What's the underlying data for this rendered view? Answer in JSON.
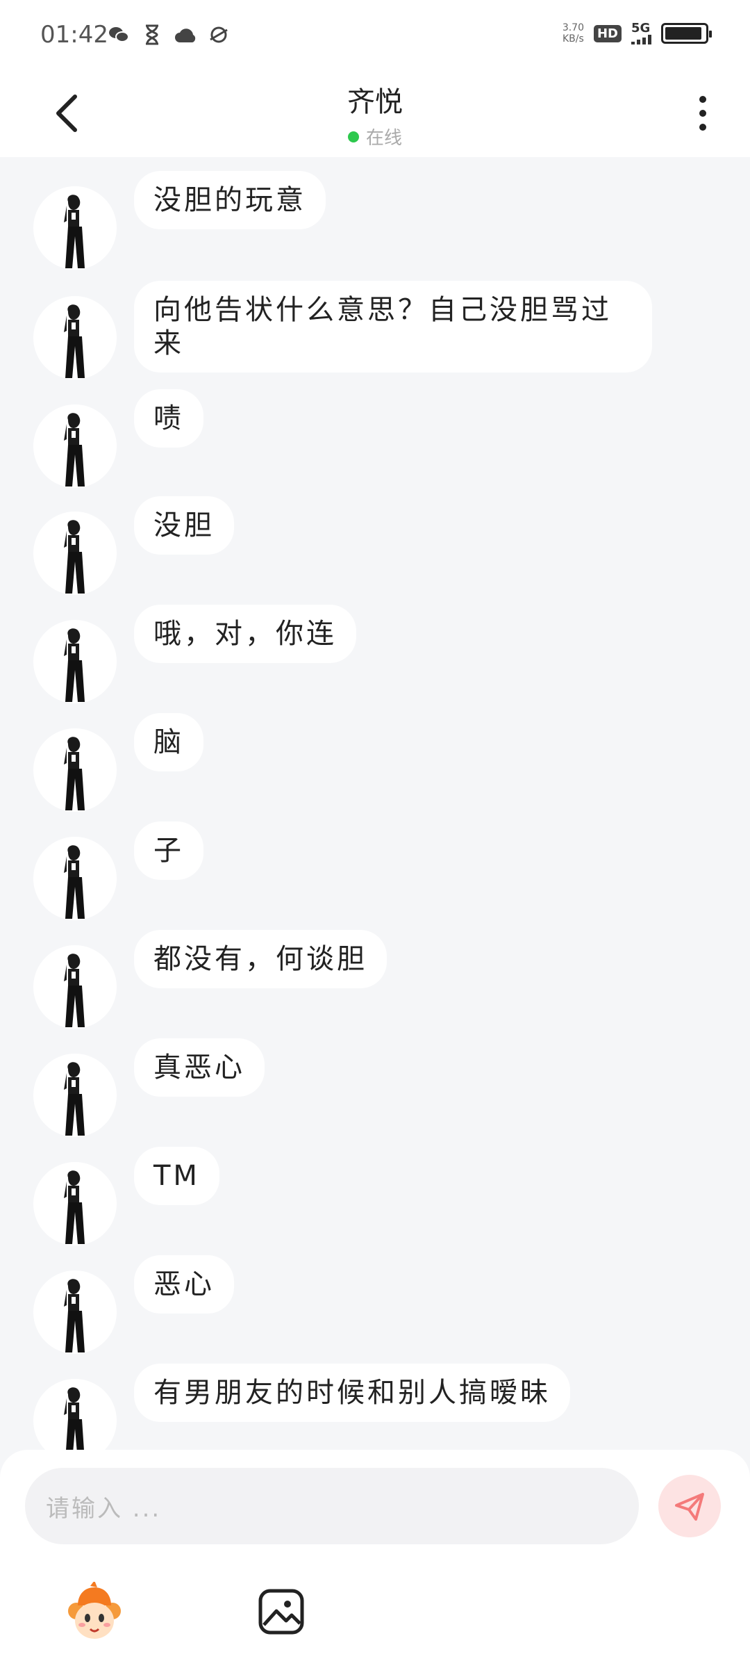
{
  "status_bar": {
    "time": "01:42",
    "speed_value": "3.70",
    "speed_unit": "KB/s",
    "hd_label": "HD",
    "network_label": "5G",
    "battery_level": 0.92
  },
  "header": {
    "title": "齐悦",
    "status": "在线"
  },
  "messages": [
    {
      "text": "没胆的玩意"
    },
    {
      "text": "向他告状什么意思？自己没胆骂过来"
    },
    {
      "text": "啧"
    },
    {
      "text": "没胆"
    },
    {
      "text": "哦，对，你连"
    },
    {
      "text": "脑"
    },
    {
      "text": "子"
    },
    {
      "text": "都没有，何谈胆"
    },
    {
      "text": "真恶心"
    },
    {
      "text": "TM"
    },
    {
      "text": "恶心"
    },
    {
      "text": "有男朋友的时候和别人搞暧昧"
    }
  ],
  "composer": {
    "placeholder": "请输入 ...",
    "send_color": "#f47a7a"
  },
  "colors": {
    "online": "#2dc84d",
    "background": "#f5f6f8",
    "bubble": "#ffffff"
  }
}
